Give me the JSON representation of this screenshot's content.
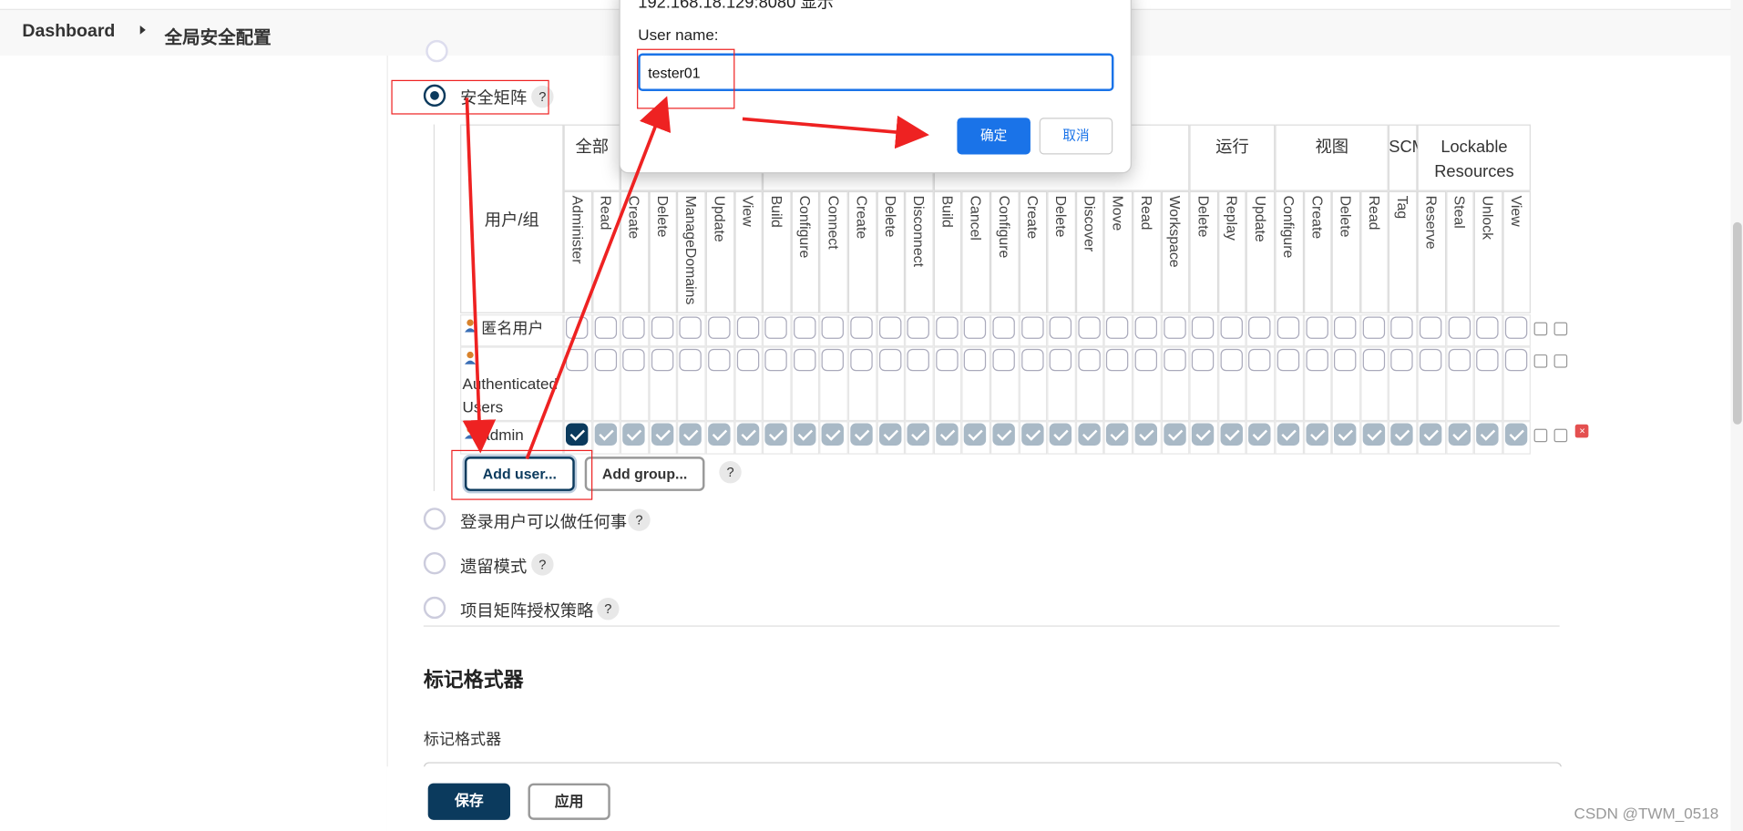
{
  "breadcrumb": {
    "home": "Dashboard",
    "current": "全局安全配置"
  },
  "auth_options": [
    {
      "label": "安全矩阵",
      "checked": true
    },
    {
      "label": "登录用户可以做任何事",
      "checked": false
    },
    {
      "label": "遗留模式",
      "checked": false
    },
    {
      "label": "项目矩阵授权策略",
      "checked": false
    }
  ],
  "help_symbol": "?",
  "matrix": {
    "user_group_header": "用户/组",
    "groups": [
      {
        "name": "全部",
        "perms": [
          "Administer",
          "Read"
        ]
      },
      {
        "name": "",
        "perms": [
          "Create",
          "Delete",
          "ManageDomains",
          "Update",
          "View"
        ]
      },
      {
        "name": "",
        "perms": [
          "Build",
          "Configure",
          "Connect",
          "Create",
          "Delete",
          "Disconnect"
        ]
      },
      {
        "name": "",
        "perms": [
          "Build",
          "Cancel",
          "Configure",
          "Create",
          "Delete",
          "Discover",
          "Move",
          "Read",
          "Workspace"
        ]
      },
      {
        "name": "运行",
        "perms": [
          "Delete",
          "Replay",
          "Update"
        ]
      },
      {
        "name": "视图",
        "perms": [
          "Configure",
          "Create",
          "Delete",
          "Read"
        ]
      },
      {
        "name": "SCM",
        "perms": [
          "Tag"
        ]
      },
      {
        "name": "Lockable Resources",
        "perms": [
          "Reserve",
          "Steal",
          "Unlock",
          "View"
        ]
      }
    ],
    "rows": [
      {
        "name": "匿名用户",
        "checked": "none"
      },
      {
        "name": "Authenticated Users",
        "checked": "none"
      },
      {
        "name": "admin",
        "checked": "all"
      }
    ]
  },
  "buttons": {
    "add_user": "Add user...",
    "add_group": "Add group...",
    "save": "保存",
    "apply": "应用"
  },
  "markup_section": {
    "title": "标记格式器",
    "field_label": "标记格式器"
  },
  "dialog": {
    "title": "192.168.18.129:8080 显示",
    "field_label": "User name:",
    "input_value": "tester01",
    "ok": "确定",
    "cancel": "取消"
  },
  "watermark": "CSDN @TWM_0518",
  "colors": {
    "accent": "#0b3a5d",
    "dialog_blue": "#1a73e8",
    "annotation_red": "#ee2222",
    "checked_box": "#a9b9c6"
  }
}
